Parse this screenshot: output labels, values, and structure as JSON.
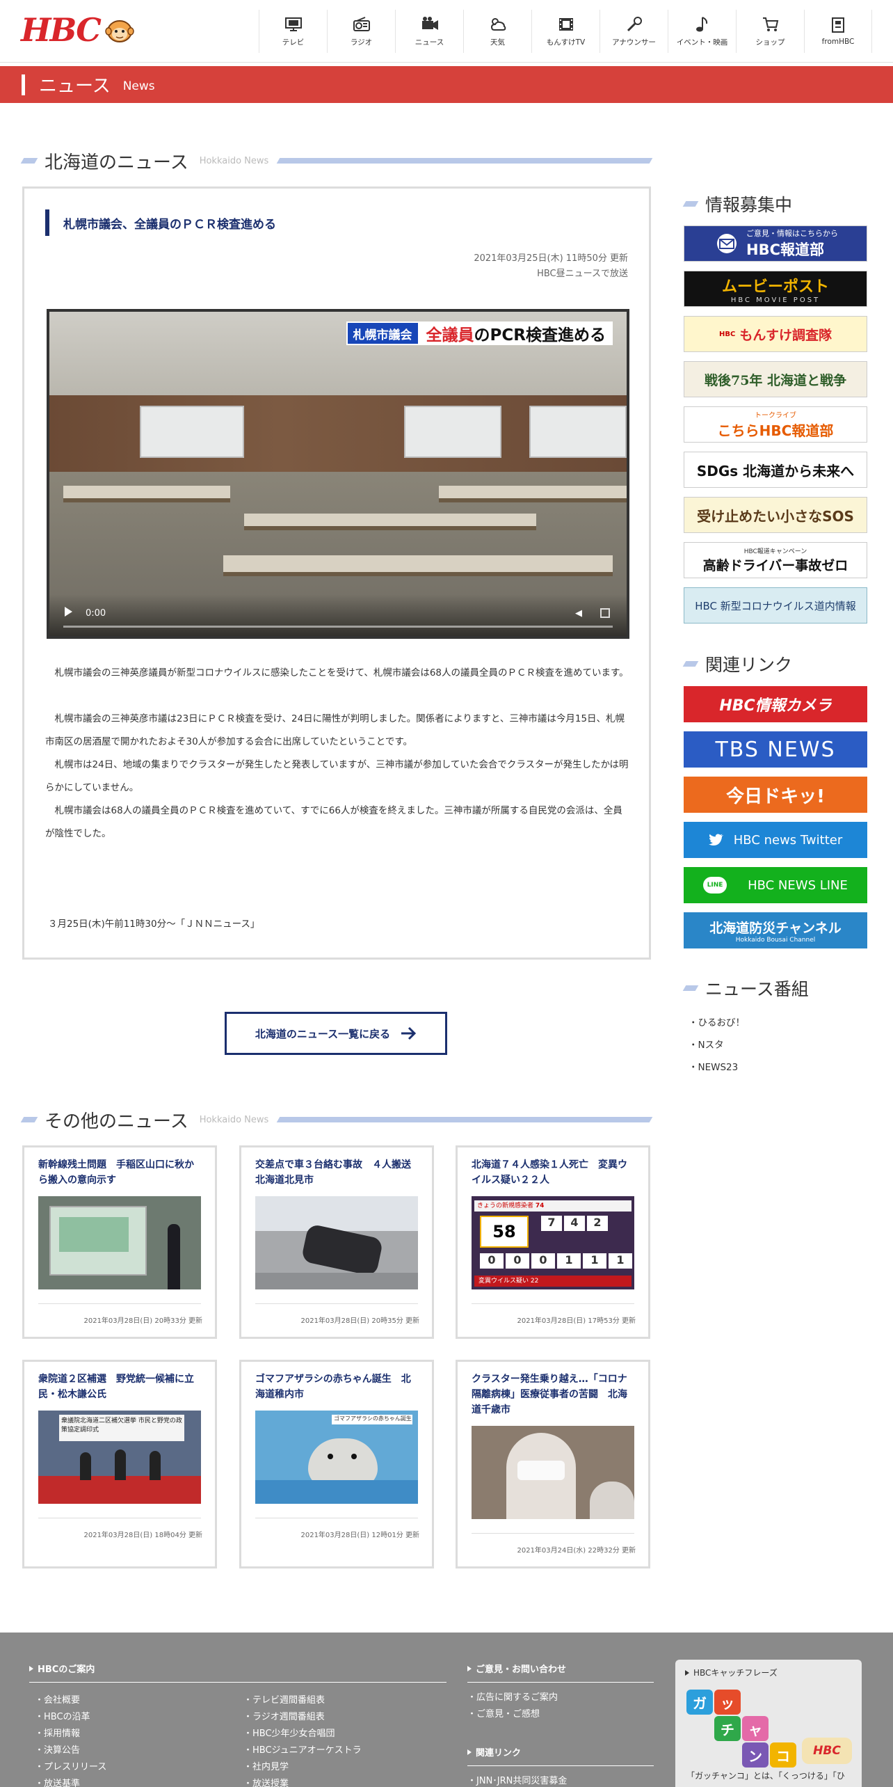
{
  "header": {
    "logo_text": "HBC",
    "nav": [
      {
        "label": "テレビ",
        "icon": "tv-icon"
      },
      {
        "label": "ラジオ",
        "icon": "radio-icon"
      },
      {
        "label": "ニュース",
        "icon": "camera-icon"
      },
      {
        "label": "天気",
        "icon": "weather-icon"
      },
      {
        "label": "もんすけTV",
        "icon": "film-icon"
      },
      {
        "label": "アナウンサー",
        "icon": "microphone-icon"
      },
      {
        "label": "イベント・映画",
        "icon": "music-note-icon"
      },
      {
        "label": "ショップ",
        "icon": "cart-icon"
      },
      {
        "label": "fromHBC",
        "icon": "document-icon"
      }
    ]
  },
  "banner": {
    "title": "ニュース",
    "subtitle": "News"
  },
  "hokkaido_section": {
    "title": "北海道のニュース",
    "subtitle": "Hokkaido News"
  },
  "article": {
    "title": "札幌市議会、全議員のＰＣＲ検査進める",
    "updated": "2021年03月25日(木) 11時50分 更新",
    "broadcast": "HBC昼ニュースで放送",
    "video": {
      "caption_label": "札幌市議会",
      "caption_main_red": "全議員",
      "caption_main_black": "のPCR検査進める",
      "time": "0:00"
    },
    "paragraphs": [
      "札幌市議会の三神英彦議員が新型コロナウイルスに感染したことを受けて、札幌市議会は68人の議員全員のＰＣＲ検査を進めています。",
      "札幌市議会の三神英彦市議は23日にＰＣＲ検査を受け、24日に陽性が判明しました。関係者によりますと、三神市議は今月15日、札幌市南区の居酒屋で開かれたおよそ30人が参加する会合に出席していたということです。",
      "札幌市は24日、地域の集まりでクラスターが発生したと発表していますが、三神市議が参加していた会合でクラスターが発生したかは明らかにしていません。",
      "札幌市議会は68人の議員全員のＰＣＲ検査を進めていて、すでに66人が検査を終えました。三神市議が所属する自民党の会派は、全員が陰性でした。"
    ],
    "footer_note": "３月25日(木)午前11時30分～「ＪＮＮニュース」"
  },
  "back_button": {
    "label": "北海道のニュース一覧に戻る"
  },
  "other_section": {
    "title": "その他のニュース",
    "subtitle": "Hokkaido News"
  },
  "cards": [
    {
      "title": "新幹線残土問題　手稲区山口に秋から搬入の意向示す",
      "date": "2021年03月28日(日) 20時33分 更新"
    },
    {
      "title": "交差点で車３台絡む事故　４人搬送　北海道北見市",
      "date": "2021年03月28日(日) 20時35分 更新"
    },
    {
      "title": "北海道７４人感染１人死亡　変異ウイルス疑い２２人",
      "date": "2021年03月28日(日) 17時53分 更新"
    },
    {
      "title": "衆院道２区補選　野党統一候補に立民・松木謙公氏",
      "date": "2021年03月28日(日) 18時04分 更新"
    },
    {
      "title": "ゴマフアザラシの赤ちゃん誕生　北海道稚内市",
      "date": "2021年03月28日(日) 12時01分 更新"
    },
    {
      "title": "クラスター発生乗り越え…「コロナ隔離病棟」医療従事者の苦闘　北海道千歳市",
      "date": "2021年03月24日(水) 22時32分 更新"
    }
  ],
  "card_images": {
    "infobox_big": "58",
    "infobox_nums": [
      "7",
      "4",
      "2",
      "0",
      "0",
      "0",
      "1",
      "1",
      "1"
    ],
    "infobox_bottom": "変異ウイルス疑い 22",
    "infobox_top": "きょうの新規感染者",
    "infobox_top_count": "74",
    "seal_caption": "ゴマフアザラシの赤ちゃん誕生",
    "election_banner": "衆議院北海道二区補欠選挙 市民と野党の政策協定調印式"
  },
  "sidebar": {
    "info_title": "情報募集中",
    "info_banners": [
      {
        "text": "HBC報道部",
        "sub": "ご意見・情報はこちらから"
      },
      {
        "text": "ムービーポスト",
        "sub": "HBC MOVIE POST"
      },
      {
        "text": "もんすけ調査隊",
        "sub": "HBC"
      },
      {
        "text": "戦後75年 北海道と戦争",
        "sub": ""
      },
      {
        "text": "こちらHBC報道部",
        "sub": "トークライブ"
      },
      {
        "text": "SDGs 北海道から未来へ",
        "sub": ""
      },
      {
        "text": "受け止めたい小さなSOS",
        "sub": ""
      },
      {
        "text": "高齢ドライバー事故ゼロ",
        "sub": "HBC報道キャンペーン"
      },
      {
        "text": "HBC 新型コロナウイルス道内情報",
        "sub": ""
      }
    ],
    "links_title": "関連リンク",
    "link_banners": [
      {
        "text": "HBC情報カメラ"
      },
      {
        "text": "TBS NEWS"
      },
      {
        "text": "今日ドキッ!"
      },
      {
        "text": "HBC news Twitter"
      },
      {
        "text": "HBC NEWS LINE"
      },
      {
        "text": "北海道防災チャンネル",
        "sub": "Hokkaido Bousai Channel"
      }
    ],
    "programs_title": "ニュース番組",
    "programs": [
      "・ひるおび！",
      "・Nスタ",
      "・NEWS23"
    ]
  },
  "footer": {
    "col1_title": "HBCのご案内",
    "col1a": [
      "会社概要",
      "HBCの沿革",
      "採用情報",
      "決算公告",
      "プレスリリース",
      "放送基準"
    ],
    "col1b": [
      "テレビ週間番組表",
      "ラジオ週間番組表",
      "HBC少年少女合唱団",
      "HBCジュニアオーケストラ",
      "社内見学",
      "放送授業"
    ],
    "col2_title": "ご意見・お問い合わせ",
    "col2": [
      "広告に関するご案内",
      "ご意見・ご感想"
    ],
    "col3_title": "関連リンク",
    "col3": [
      "JNN･JRN共同災害募金"
    ],
    "catch_title": "HBCキャッチフレーズ",
    "catch_letters": [
      "ガ",
      "ッ",
      "チ",
      "ャ",
      "ン",
      "コ"
    ],
    "catch_logo": "HBC",
    "catch_note": "「ガッチャンコ」とは、「くっつける」「ひ"
  },
  "colors": {
    "brand_red": "#d9262b",
    "navy": "#1b2f6e",
    "banner_red": "#d6413b",
    "footer_gray": "#8a8a8a"
  }
}
